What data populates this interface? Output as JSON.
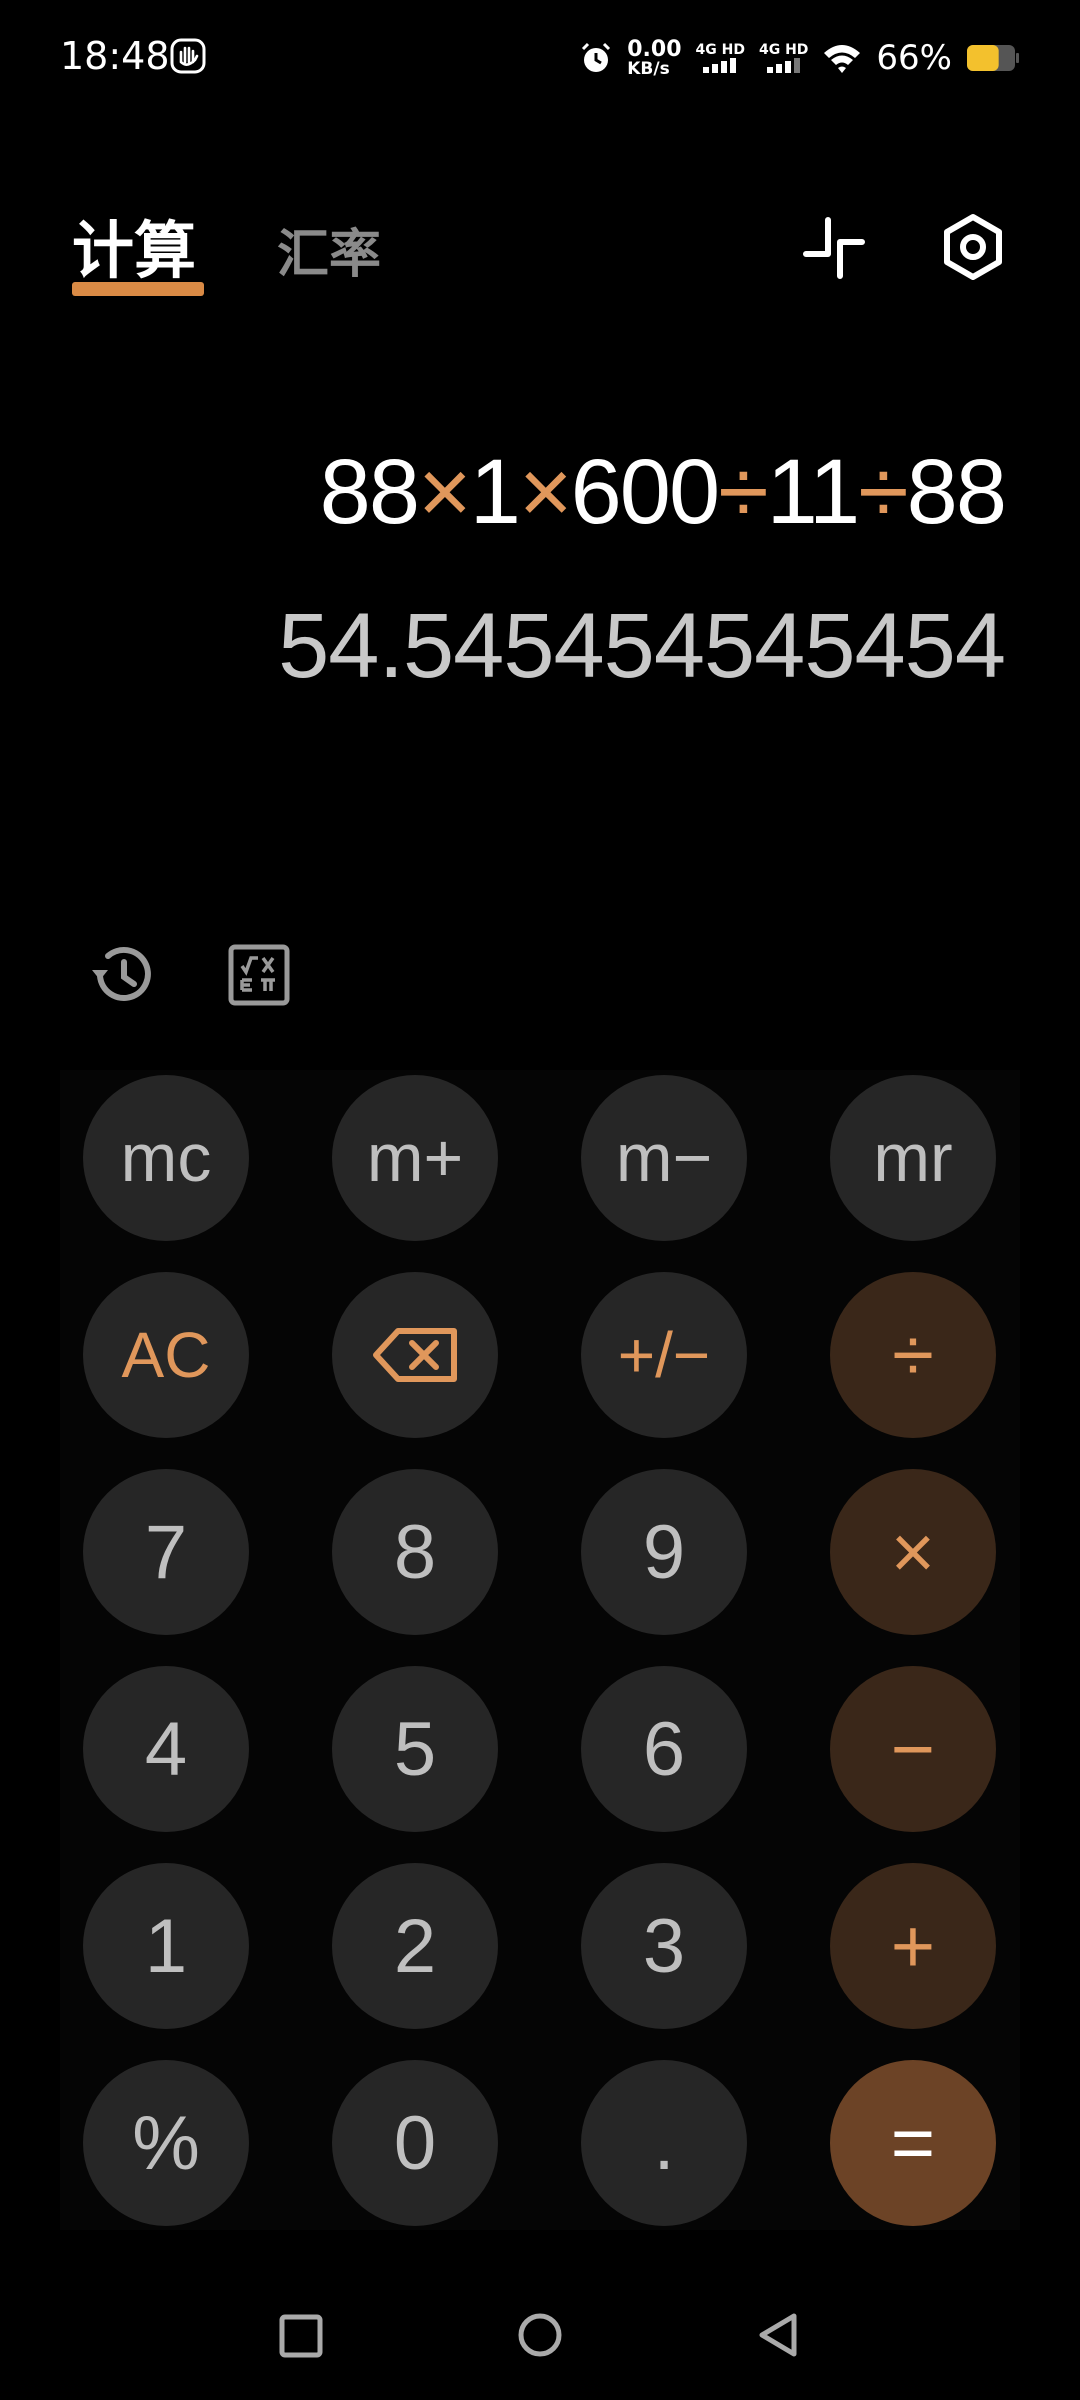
{
  "status_bar": {
    "time": "18:48",
    "net_speed_value": "0.00",
    "net_speed_unit": "KB/s",
    "sim1_label": "4G HD",
    "sim2_label": "4G HD",
    "battery_percent": "66%",
    "battery_level": 0.66
  },
  "tabs": {
    "calc": "计算",
    "exchange": "汇率"
  },
  "display": {
    "expression": [
      {
        "t": "88",
        "op": false
      },
      {
        "t": "×",
        "op": true
      },
      {
        "t": "1",
        "op": false
      },
      {
        "t": "×",
        "op": true
      },
      {
        "t": "600",
        "op": false
      },
      {
        "t": "÷",
        "op": true
      },
      {
        "t": "11",
        "op": false
      },
      {
        "t": "÷",
        "op": true
      },
      {
        "t": "88",
        "op": false
      }
    ],
    "result": "54.545454545454"
  },
  "keypad": {
    "mc": "mc",
    "mplus": "m+",
    "mminus": "m−",
    "mr": "mr",
    "ac": "AC",
    "sign": "+/−",
    "divide": "÷",
    "seven": "7",
    "eight": "8",
    "nine": "9",
    "multiply": "×",
    "four": "4",
    "five": "5",
    "six": "6",
    "minus": "−",
    "one": "1",
    "two": "2",
    "three": "3",
    "plus": "+",
    "percent": "%",
    "zero": "0",
    "dot": ".",
    "equals": "="
  },
  "colors": {
    "accent": "#e0975b",
    "op_key_bg": "#3a2719",
    "equals_bg": "#6c4326",
    "key_bg": "#262626"
  }
}
